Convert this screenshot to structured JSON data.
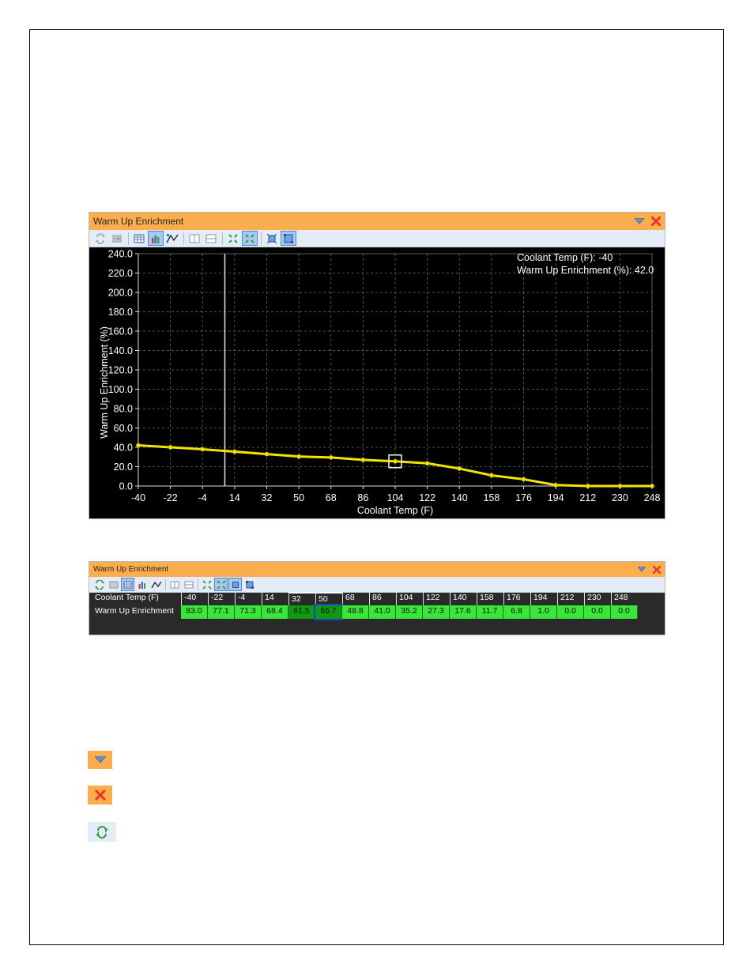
{
  "chart_window": {
    "title": "Warm Up Enrichment",
    "readout": {
      "x_line": "Coolant Temp (F): -40",
      "y_line": "Warm Up Enrichment (%): 42.0"
    }
  },
  "table_window": {
    "title": "Warm Up Enrichment",
    "row_labels": [
      "Coolant Temp (F)",
      "Warm Up Enrichment"
    ],
    "headers": [
      "-40",
      "-22",
      "-4",
      "14",
      "32",
      "50",
      "68",
      "86",
      "104",
      "122",
      "140",
      "158",
      "176",
      "194",
      "212",
      "230",
      "248"
    ],
    "values": [
      "83.0",
      "77.1",
      "71.3",
      "68.4",
      "61.5",
      "55.7",
      "48.8",
      "41.0",
      "35.2",
      "27.3",
      "17.6",
      "11.7",
      "6.8",
      "1.0",
      "0.0",
      "0.0",
      "0.0"
    ],
    "selected_columns": [
      4,
      5
    ]
  },
  "icons": {
    "dropdown": "dropdown-arrow-icon",
    "close": "close-x-icon",
    "refresh": "refresh-arrows-icon"
  },
  "colors": {
    "titlebar": "#fcae4e",
    "line": "#f2e600",
    "cell_green": "#39e639",
    "cell_dark_green": "#0f9b0f"
  },
  "chart_data": {
    "type": "line",
    "xlabel": "Coolant Temp (F)",
    "ylabel": "Warm Up Enrichment (%)",
    "x": [
      -40,
      -22,
      -4,
      14,
      32,
      50,
      68,
      86,
      104,
      122,
      140,
      158,
      176,
      194,
      212,
      230,
      248
    ],
    "x_ticks": [
      "-40",
      "-22",
      "-4",
      "14",
      "32",
      "50",
      "68",
      "86",
      "104",
      "122",
      "140",
      "158",
      "176",
      "194",
      "212",
      "230",
      "248"
    ],
    "y_ticks": [
      "0.0",
      "20.0",
      "40.0",
      "60.0",
      "80.0",
      "100.0",
      "120.0",
      "140.0",
      "160.0",
      "180.0",
      "200.0",
      "220.0",
      "240.0"
    ],
    "series": [
      {
        "values": [
          42.0,
          40.0,
          38.0,
          35.5,
          33.0,
          30.5,
          29.5,
          27.0,
          25.5,
          23.5,
          18.0,
          11.0,
          7.0,
          1.0,
          0.0,
          0.0,
          0.0
        ]
      }
    ],
    "xlim": [
      -40,
      248
    ],
    "ylim": [
      0,
      240
    ],
    "grid": true,
    "cursor_x": -4,
    "selected_x": 104
  }
}
